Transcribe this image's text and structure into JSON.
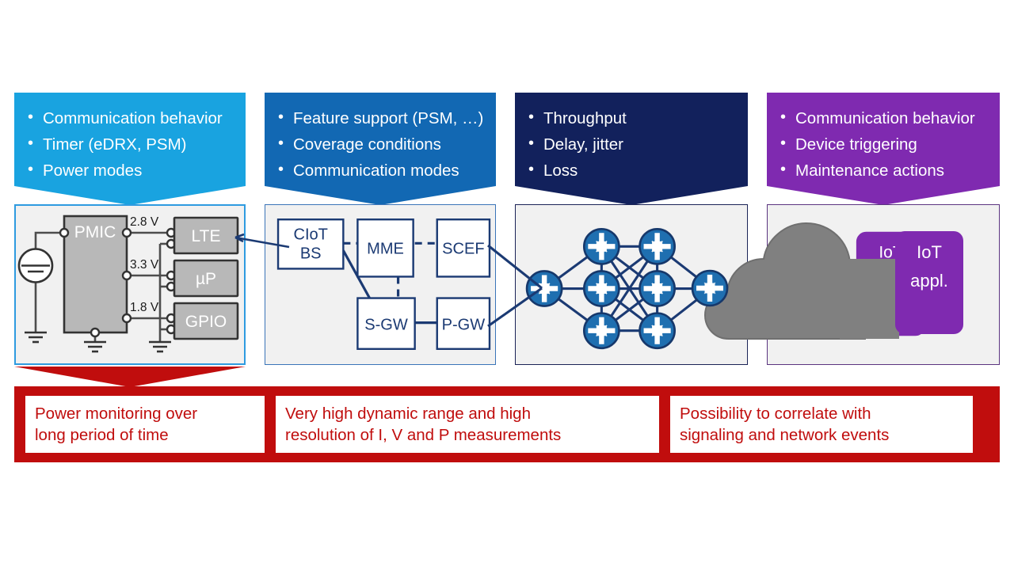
{
  "banners": [
    {
      "id": "device",
      "color": "#19a3e0",
      "items": [
        "Communication behavior",
        "Timer (eDRX, PSM)",
        "Power modes"
      ]
    },
    {
      "id": "radio-access",
      "color": "#1268b3",
      "items": [
        "Feature support (PSM, …)",
        "Coverage conditions",
        "Communication modes"
      ]
    },
    {
      "id": "transport",
      "color": "#12215c",
      "items": [
        "Throughput",
        "Delay, jitter",
        "Loss"
      ]
    },
    {
      "id": "application",
      "color": "#7f2ab0",
      "items": [
        "Communication behavior",
        "Device triggering",
        "Maintenance actions"
      ]
    }
  ],
  "panels": {
    "device": {
      "border_color": "#2e9be0",
      "blocks": [
        {
          "label": "PMIC"
        },
        {
          "label": "LTE"
        },
        {
          "label": "µP"
        },
        {
          "label": "GPIO"
        }
      ],
      "rail_labels": [
        "2.8 V",
        "3.3 V",
        "1.8 V"
      ]
    },
    "core_network": {
      "border_color": "#3a74b8",
      "nodes": [
        {
          "label_line1": "CIoT",
          "label_line2": "BS"
        },
        {
          "label_line1": "MME",
          "label_line2": ""
        },
        {
          "label_line1": "SCEF",
          "label_line2": ""
        },
        {
          "label_line1": "S-GW",
          "label_line2": ""
        },
        {
          "label_line1": "P-GW",
          "label_line2": ""
        }
      ]
    },
    "ip_network": {
      "border_color": "#1a2356",
      "router_count": 8,
      "router_icon": "router-icon",
      "router_fill": "#1f6fb0",
      "router_stroke": "#16386b"
    },
    "cloud_application": {
      "border_color": "#5b3480",
      "cloud_icon": "cloud-icon",
      "cloud_fill": "#808080",
      "app_box": {
        "fill": "#7f2ab0",
        "label_line1": "IoT",
        "label_line2": "appl."
      }
    }
  },
  "conclusions": {
    "accent_color": "#c00d0d",
    "cards": [
      {
        "line1": "Power monitoring over",
        "line2": "long period of time"
      },
      {
        "line1": "Very high dynamic range and high",
        "line2": "resolution of I, V and P measurements"
      },
      {
        "line1": "Possibility to correlate with",
        "line2": "signaling and network events"
      }
    ]
  }
}
